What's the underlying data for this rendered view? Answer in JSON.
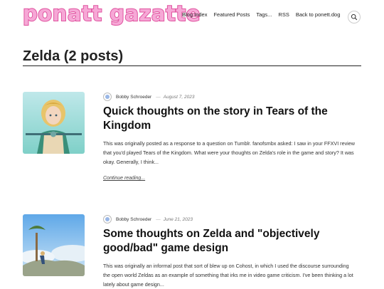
{
  "site": {
    "logo": "ponatt gazatte"
  },
  "nav": {
    "items": [
      "Blog Index",
      "Featured Posts",
      "Tags...",
      "RSS",
      "Back to ponett.dog"
    ]
  },
  "search": {
    "icon": "search-icon"
  },
  "page": {
    "title": "Zelda (2 posts)"
  },
  "posts": [
    {
      "author": "Bobby Schroeder",
      "separator": "—",
      "date": "August 7, 2023",
      "title": "Quick thoughts on the story in Tears of the Kingdom",
      "excerpt": "This was originally posted as a response to a question on Tumblr. fanofsmbx asked: I saw in your FFXVI review that you'd played Tears of the Kingdom. What were your thoughts on Zelda's role in the game and story? It was okay. Generally, I think...",
      "more": "Continue reading..."
    },
    {
      "author": "Bobby Schroeder",
      "separator": "—",
      "date": "June 21, 2023",
      "title": "Some thoughts on Zelda and \"objectively good/bad\" game design",
      "excerpt": "This was originally an informal post that sort of blew up on Cohost, in which I used the discourse surrounding the open world Zeldas as an example of something that irks me in video game criticism. I've been thinking a lot lately about game design..."
    }
  ]
}
